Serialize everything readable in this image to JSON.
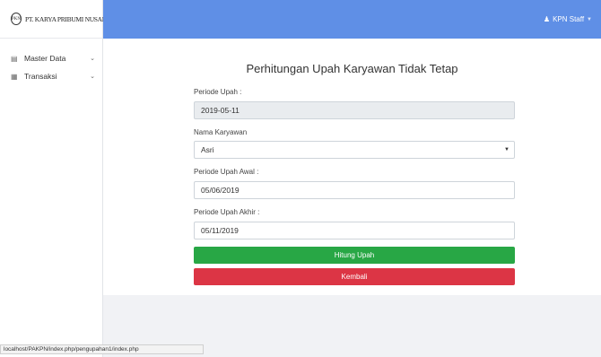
{
  "brand": {
    "logo_text": "PKN",
    "name": "PT. KARYA PRIBUMI NUSANTARA"
  },
  "sidebar": {
    "items": [
      {
        "label": "Master Data",
        "icon": "database-icon"
      },
      {
        "label": "Transaksi",
        "icon": "table-icon"
      }
    ]
  },
  "topbar": {
    "user_label": "KPN Staff",
    "accent": "#5f8fe6"
  },
  "form": {
    "title": "Perhitungan Upah Karyawan Tidak Tetap",
    "periode_label": "Periode Upah :",
    "periode_value": "2019-05-11",
    "nama_label": "Nama Karyawan",
    "nama_value": "Asri",
    "awal_label": "Periode Upah Awal :",
    "awal_value": "05/06/2019",
    "akhir_label": "Periode Upah Akhir :",
    "akhir_value": "05/11/2019",
    "hitung_label": "Hitung Upah",
    "kembali_label": "Kembali",
    "colors": {
      "green": "#28a745",
      "red": "#dc3545"
    }
  },
  "statusbar": {
    "url": "localhost/PAKPN/index.php/pengupahan1/index.php"
  }
}
